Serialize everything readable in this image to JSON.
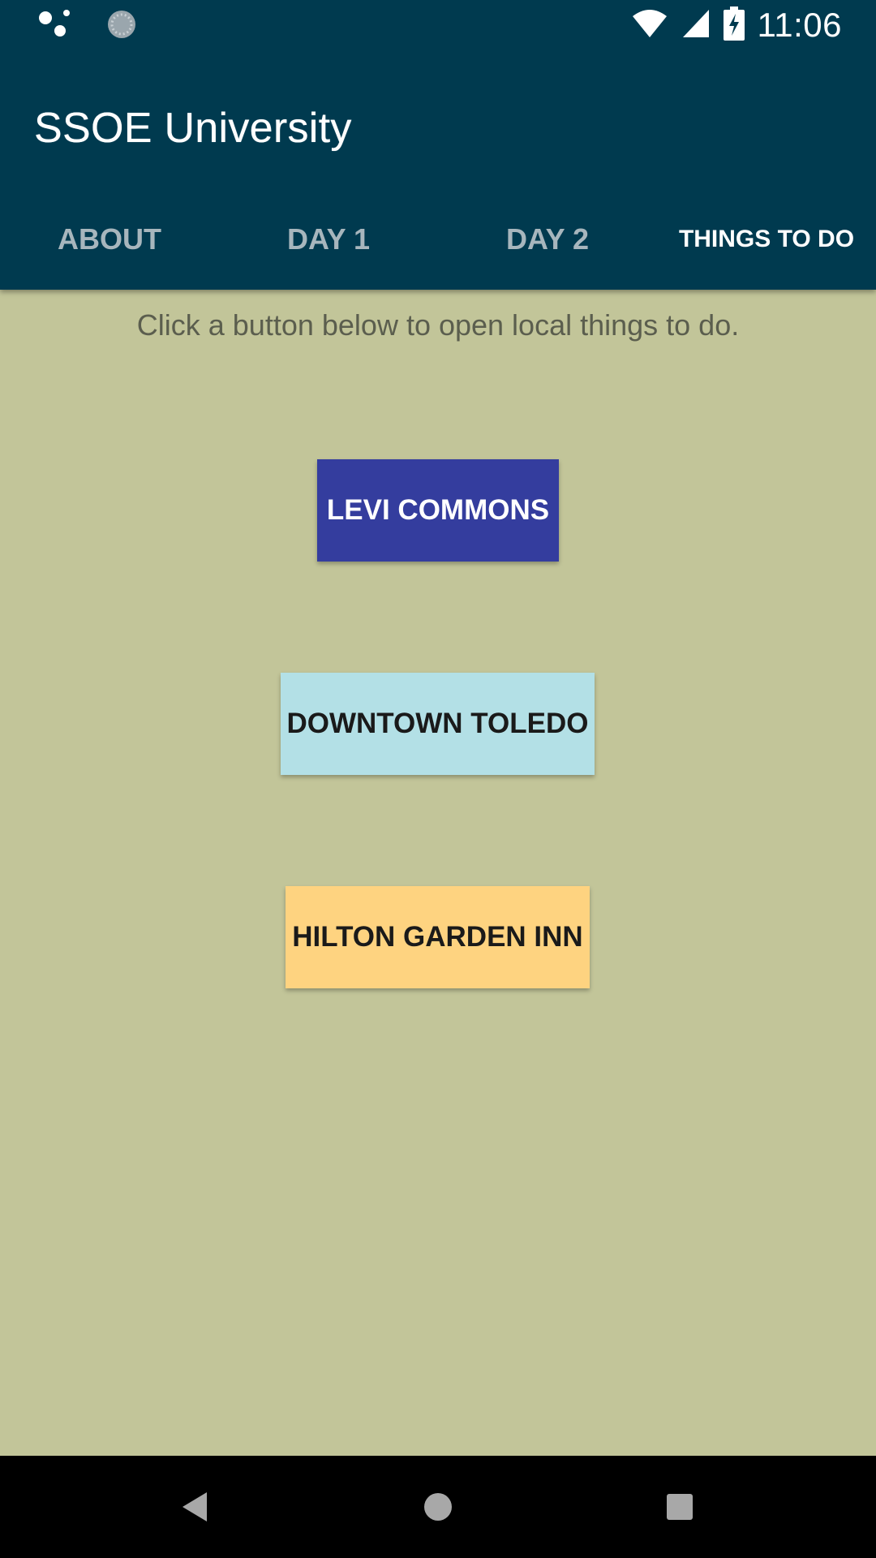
{
  "status_bar": {
    "time": "11:06",
    "icons": [
      "assistant-dots-icon",
      "loading-spinner-icon",
      "wifi-icon",
      "cell-signal-icon",
      "battery-charging-icon"
    ]
  },
  "app_bar": {
    "title": "SSOE University",
    "background_color": "#003a4f"
  },
  "tabs": [
    {
      "label": "ABOUT",
      "active": false
    },
    {
      "label": "DAY 1",
      "active": false
    },
    {
      "label": "DAY 2",
      "active": false
    },
    {
      "label": "THINGS TO DO",
      "active": true
    }
  ],
  "main": {
    "instruction": "Click a button below to open local things to do.",
    "background_color": "#c2c599",
    "buttons": [
      {
        "label": "LEVI COMMONS",
        "color": "#343d9e",
        "text_color": "#ffffff"
      },
      {
        "label": "DOWNTOWN TOLEDO",
        "color": "#b3e0e6",
        "text_color": "#1a1a1a"
      },
      {
        "label": "HILTON GARDEN INN",
        "color": "#fed380",
        "text_color": "#1a1a1a"
      }
    ]
  },
  "nav_bar": {
    "icons": [
      "back-icon",
      "home-icon",
      "recents-icon"
    ]
  }
}
